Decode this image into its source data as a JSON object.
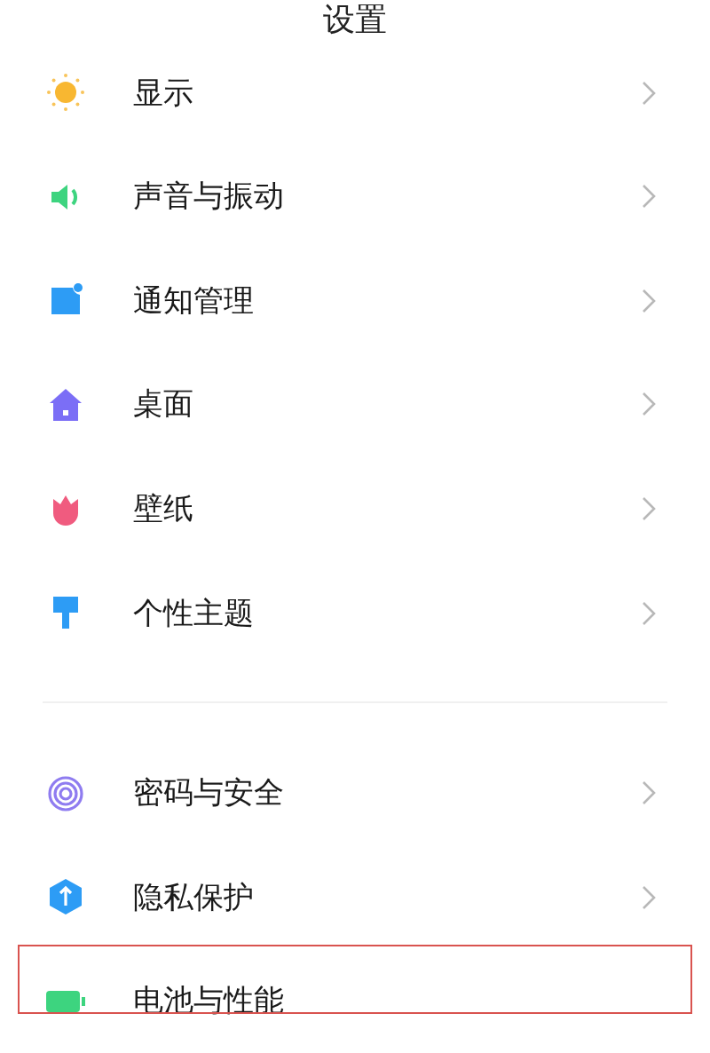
{
  "title": "设置",
  "groups": [
    {
      "items": [
        {
          "label": "显示",
          "kind": "sun",
          "chevron": true,
          "highlighted": false
        },
        {
          "label": "声音与振动",
          "kind": "speaker",
          "chevron": true,
          "highlighted": false
        },
        {
          "label": "通知管理",
          "kind": "notification",
          "chevron": true,
          "highlighted": false
        },
        {
          "label": "桌面",
          "kind": "home",
          "chevron": true,
          "highlighted": false
        },
        {
          "label": "壁纸",
          "kind": "flower",
          "chevron": true,
          "highlighted": false
        },
        {
          "label": "个性主题",
          "kind": "brush",
          "chevron": true,
          "highlighted": false
        }
      ]
    },
    {
      "items": [
        {
          "label": "密码与安全",
          "kind": "fingerprint",
          "chevron": true,
          "highlighted": false
        },
        {
          "label": "隐私保护",
          "kind": "shield",
          "chevron": true,
          "highlighted": false
        },
        {
          "label": "电池与性能",
          "kind": "battery",
          "chevron": false,
          "highlighted": true
        }
      ]
    }
  ]
}
